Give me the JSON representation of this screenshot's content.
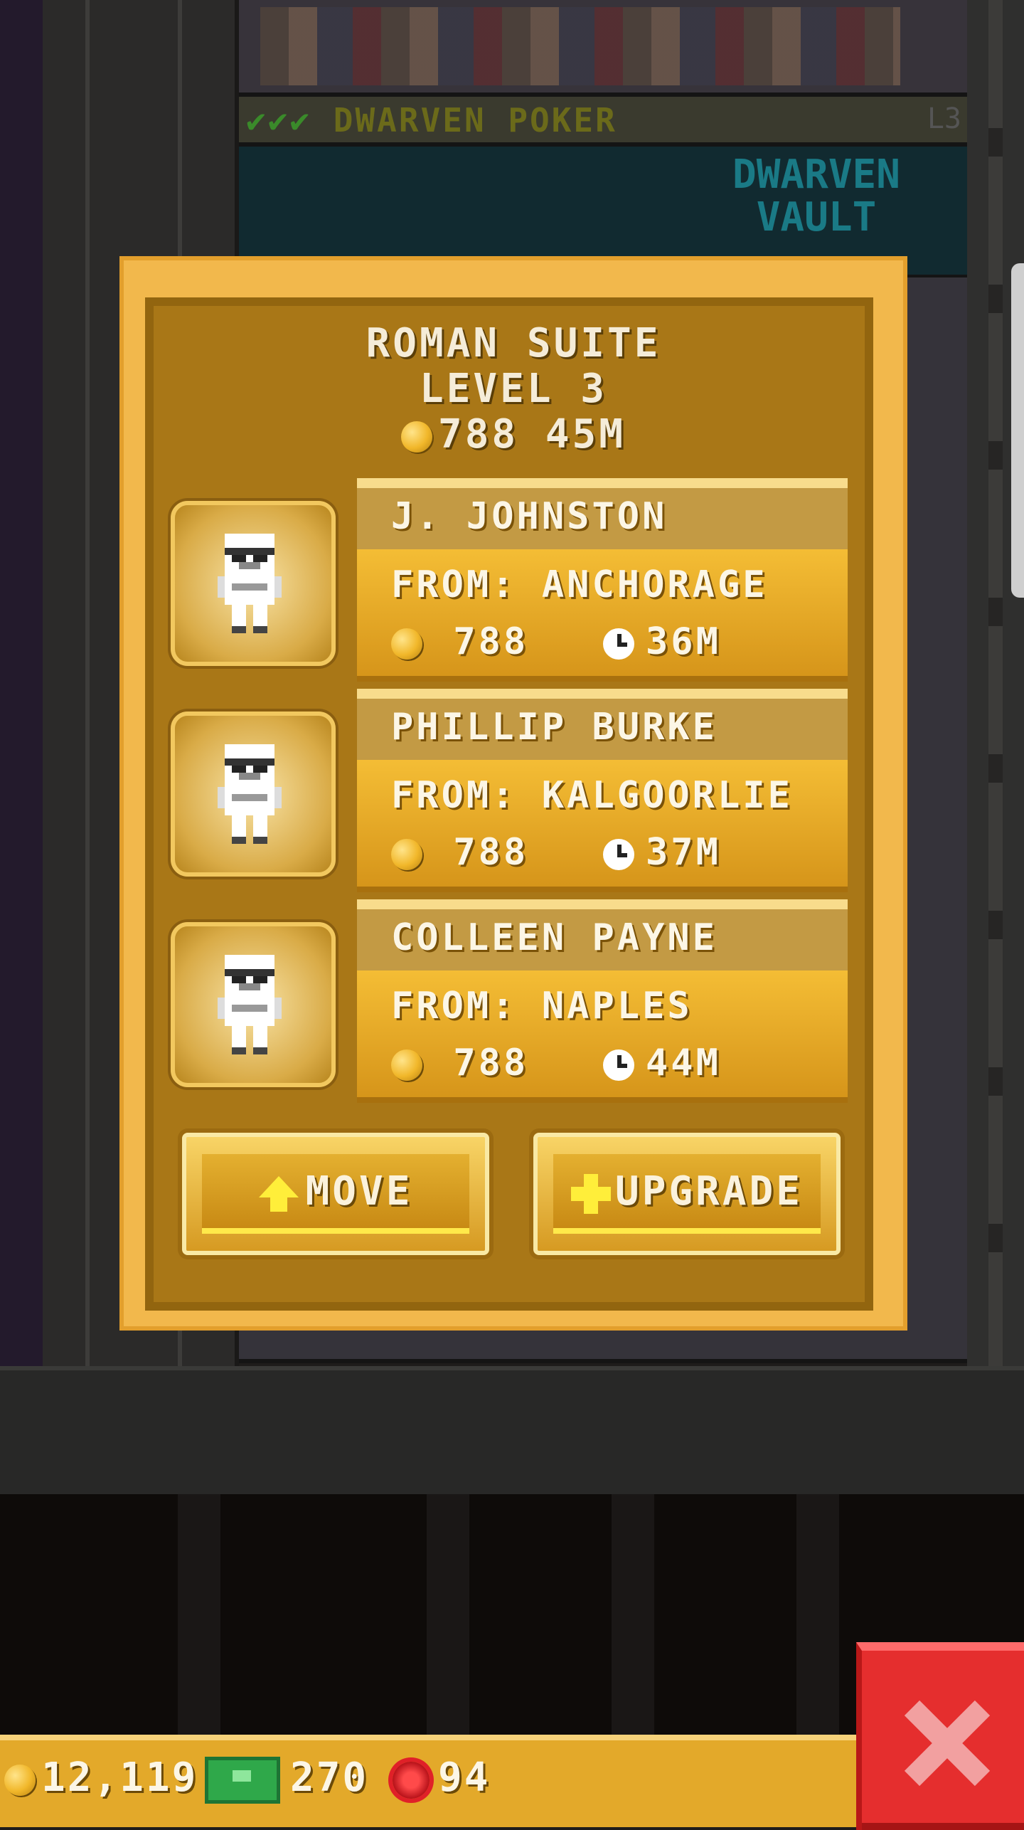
{
  "background": {
    "poker_floor": {
      "checks": "✔✔✔",
      "name": "DWARVEN POKER",
      "level": "L3"
    },
    "vault_sign": "DWARVEN VAULT"
  },
  "dialog": {
    "title": "ROMAN SUITE",
    "level": "LEVEL 3",
    "rent": "788 45M",
    "residents": [
      {
        "name": "J. JOHNSTON",
        "from": "FROM: ANCHORAGE",
        "coins": "788",
        "time": "36M"
      },
      {
        "name": "PHILLIP BURKE",
        "from": "FROM: KALGOORLIE",
        "coins": "788",
        "time": "37M"
      },
      {
        "name": "COLLEEN PAYNE",
        "from": "FROM: NAPLES",
        "coins": "788",
        "time": "44M"
      }
    ],
    "buttons": {
      "move": "MOVE",
      "upgrade": "UPGRADE"
    }
  },
  "hud": {
    "coins": "12,119",
    "bux_cash": "270",
    "tokens": "94"
  },
  "icons": {
    "coin": "coin-icon",
    "clock": "clock-icon",
    "move": "arrow-up-icon",
    "upgrade": "plus-icon",
    "cash": "cash-icon",
    "token": "bux-icon",
    "close": "close-icon"
  },
  "colors": {
    "panel": "#a97717",
    "panel_border": "#f2b84c",
    "close": "#e52e2e",
    "hud": "#e3a92a"
  }
}
